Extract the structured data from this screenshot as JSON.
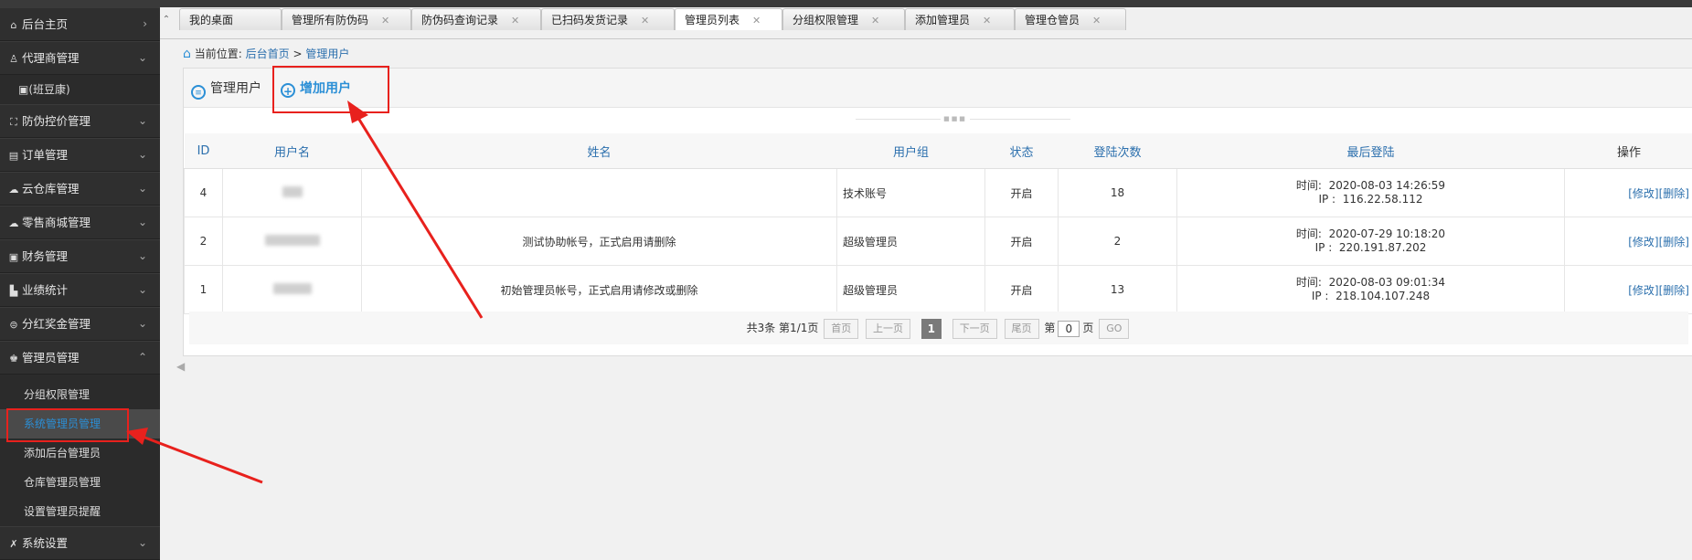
{
  "sidebar": {
    "items": [
      {
        "label": "后台主页",
        "icon": "home-icon",
        "chev": "›"
      },
      {
        "label": "代理商管理",
        "icon": "user-icon",
        "chev": "⌄"
      },
      {
        "label": "防伪控价管理",
        "icon": "shield-icon",
        "chev": "⌄"
      },
      {
        "label": "订单管理",
        "icon": "order-icon",
        "chev": "⌄"
      },
      {
        "label": "云仓库管理",
        "icon": "cloud-icon",
        "chev": "⌄"
      },
      {
        "label": "零售商城管理",
        "icon": "store-icon",
        "chev": "⌄"
      },
      {
        "label": "财务管理",
        "icon": "finance-icon",
        "chev": "⌄"
      },
      {
        "label": "业绩统计",
        "icon": "chart-icon",
        "chev": "⌄"
      },
      {
        "label": "分红奖金管理",
        "icon": "bonus-icon",
        "chev": "⌄"
      },
      {
        "label": "管理员管理",
        "icon": "admin-icon",
        "chev": "⌃"
      },
      {
        "label": "系统设置",
        "icon": "wrench-icon",
        "chev": "⌄"
      }
    ],
    "agent_sub": "(班豆康)",
    "admin_sub": [
      "分组权限管理",
      "系统管理员管理",
      "添加后台管理员",
      "仓库管理员管理",
      "设置管理员提醒"
    ]
  },
  "tabs": [
    {
      "label": "我的桌面",
      "closable": false
    },
    {
      "label": "管理所有防伪码",
      "closable": true
    },
    {
      "label": "防伪码查询记录",
      "closable": true
    },
    {
      "label": "已扫码发货记录",
      "closable": true
    },
    {
      "label": "管理员列表",
      "closable": true
    },
    {
      "label": "分组权限管理",
      "closable": true
    },
    {
      "label": "添加管理员",
      "closable": true
    },
    {
      "label": "管理仓管员",
      "closable": true
    }
  ],
  "breadcrumb": {
    "prefix": "当前位置:",
    "home": "后台首页",
    "sep": ">",
    "current": "管理用户"
  },
  "actions": {
    "manage": "管理用户",
    "add": "增加用户"
  },
  "table": {
    "headers": [
      "ID",
      "用户名",
      "姓名",
      "用户组",
      "状态",
      "登陆次数",
      "最后登陆",
      "操作"
    ],
    "rows": [
      {
        "id": "4",
        "name": "",
        "group": "技术账号",
        "status": "开启",
        "logins": "18",
        "time_label": "时间:",
        "time": "2020-08-03 14:26:59",
        "ip_label": "IP  :",
        "ip": "116.22.58.112",
        "edit": "[修改]",
        "del": "[删除]"
      },
      {
        "id": "2",
        "name": "测试协助帐号，正式启用请删除",
        "group": "超级管理员",
        "status": "开启",
        "logins": "2",
        "time_label": "时间:",
        "time": "2020-07-29 10:18:20",
        "ip_label": "IP  :",
        "ip": "220.191.87.202",
        "edit": "[修改]",
        "del": "[删除]"
      },
      {
        "id": "1",
        "name": "初始管理员帐号，正式启用请修改或删除",
        "group": "超级管理员",
        "status": "开启",
        "logins": "13",
        "time_label": "时间:",
        "time": "2020-08-03 09:01:34",
        "ip_label": "IP  :",
        "ip": "218.104.107.248",
        "edit": "[修改]",
        "del": "[删除]"
      }
    ]
  },
  "pager": {
    "summary": "共3条  第1/1页",
    "first": "首页",
    "prev": "上一页",
    "current": "1",
    "next": "下一页",
    "last": "尾页",
    "goto_prefix": "第",
    "page_value": "0",
    "goto_suffix": "页",
    "go": "GO"
  },
  "colors": {
    "accent": "#2b8fd6",
    "annotation": "#e8211d",
    "sidebar": "#2f2f2f"
  }
}
